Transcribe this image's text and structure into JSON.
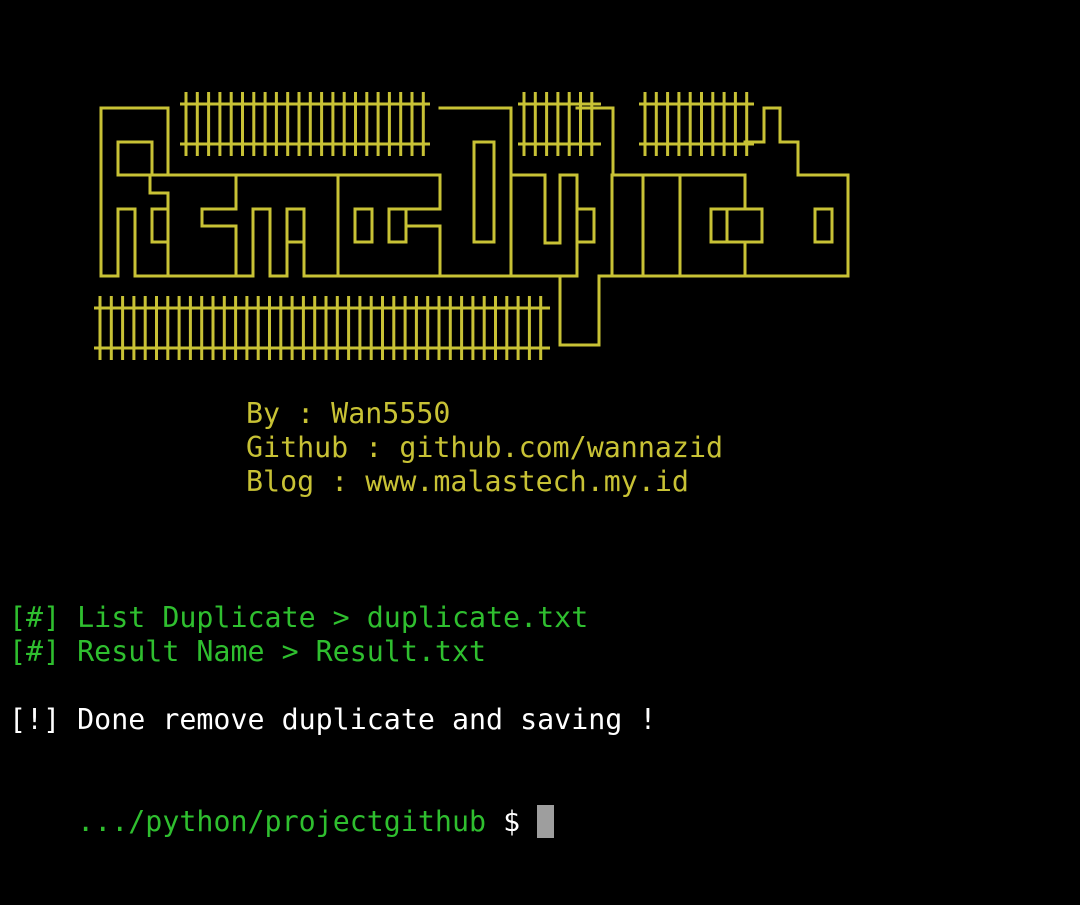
{
  "colors": {
    "background": "#000000",
    "banner": "#c8c235",
    "info": "#c8c235",
    "status": "#2fbf2f",
    "message": "#ffffff",
    "prompt_path": "#2fbf2f",
    "cursor": "#9e9e9e"
  },
  "banner": {
    "logo_text": "RemoveDuplicate",
    "credits": [
      "By : Wan5550",
      "Github : github.com/wannazid",
      "Blog : www.malastech.my.id"
    ]
  },
  "output": {
    "status_lines": [
      "[#] List Duplicate > duplicate.txt",
      "[#] Result Name > Result.txt"
    ],
    "done_message": "[!] Done remove duplicate and saving !"
  },
  "prompt": {
    "path": ".../python/projectgithub",
    "symbol": "$"
  }
}
